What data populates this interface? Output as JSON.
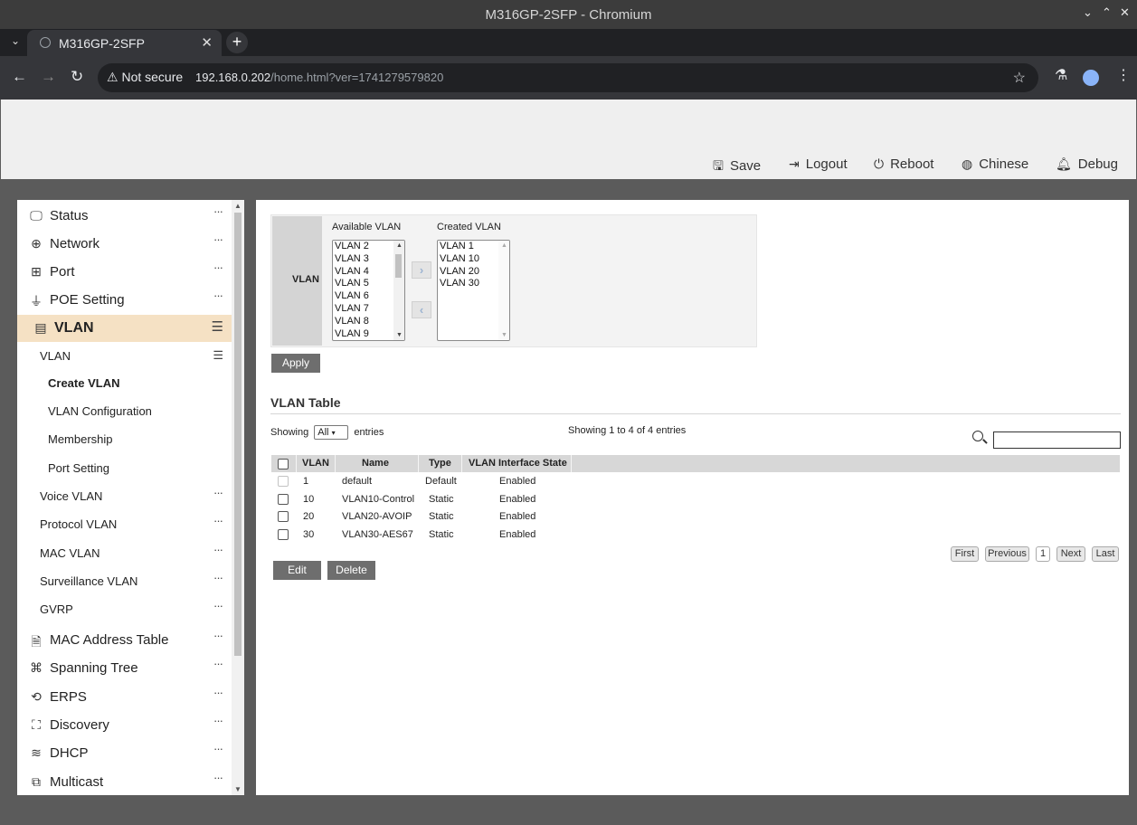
{
  "browser": {
    "window_title": "M316GP-2SFP - Chromium",
    "tab_title": "M316GP-2SFP",
    "security_label": "Not secure",
    "url_host": "192.168.0.202",
    "url_path": "/home.html?ver=1741279579820"
  },
  "header_actions": [
    {
      "label": "Save",
      "icon": "save-icon"
    },
    {
      "label": "Logout",
      "icon": "logout-icon"
    },
    {
      "label": "Reboot",
      "icon": "power-icon"
    },
    {
      "label": "Chinese",
      "icon": "globe-icon"
    },
    {
      "label": "Debug",
      "icon": "bell-icon"
    }
  ],
  "sidebar": {
    "top_items": [
      {
        "label": "Status",
        "icon": "monitor-icon"
      },
      {
        "label": "Network",
        "icon": "globe-icon"
      },
      {
        "label": "Port",
        "icon": "port-icon"
      },
      {
        "label": "POE Setting",
        "icon": "plug-icon"
      }
    ],
    "active_item": {
      "label": "VLAN",
      "icon": "list-icon"
    },
    "vlan_group": "VLAN",
    "vlan_subitems": [
      "Create VLAN",
      "VLAN Configuration",
      "Membership",
      "Port Setting"
    ],
    "vlan_items": [
      "Voice VLAN",
      "Protocol VLAN",
      "MAC VLAN",
      "Surveillance VLAN",
      "GVRP"
    ],
    "bottom_items": [
      {
        "label": "MAC Address Table",
        "icon": "table-search-icon"
      },
      {
        "label": "Spanning Tree",
        "icon": "tree-icon"
      },
      {
        "label": "ERPS",
        "icon": "ring-icon"
      },
      {
        "label": "Discovery",
        "icon": "hierarchy-icon"
      },
      {
        "label": "DHCP",
        "icon": "database-icon"
      },
      {
        "label": "Multicast",
        "icon": "multicast-icon"
      }
    ]
  },
  "create_vlan": {
    "row_label": "VLAN",
    "available_title": "Available VLAN",
    "created_title": "Created VLAN",
    "available": [
      "VLAN 2",
      "VLAN 3",
      "VLAN 4",
      "VLAN 5",
      "VLAN 6",
      "VLAN 7",
      "VLAN 8",
      "VLAN 9"
    ],
    "created": [
      "VLAN 1",
      "VLAN 10",
      "VLAN 20",
      "VLAN 30"
    ],
    "apply_label": "Apply"
  },
  "vlan_table": {
    "title": "VLAN Table",
    "showing_prefix": "Showing",
    "entries_select": "All",
    "entries_suffix": "entries",
    "info": "Showing 1 to 4 of 4 entries",
    "columns": [
      "VLAN",
      "Name",
      "Type",
      "VLAN Interface State"
    ],
    "rows": [
      {
        "vlan": "1",
        "name": "default",
        "type": "Default",
        "state": "Enabled"
      },
      {
        "vlan": "10",
        "name": "VLAN10-Control",
        "type": "Static",
        "state": "Enabled"
      },
      {
        "vlan": "20",
        "name": "VLAN20-AVOIP",
        "type": "Static",
        "state": "Enabled"
      },
      {
        "vlan": "30",
        "name": "VLAN30-AES67",
        "type": "Static",
        "state": "Enabled"
      }
    ],
    "pagination": {
      "first": "First",
      "previous": "Previous",
      "current": "1",
      "next": "Next",
      "last": "Last"
    },
    "edit_label": "Edit",
    "delete_label": "Delete"
  }
}
